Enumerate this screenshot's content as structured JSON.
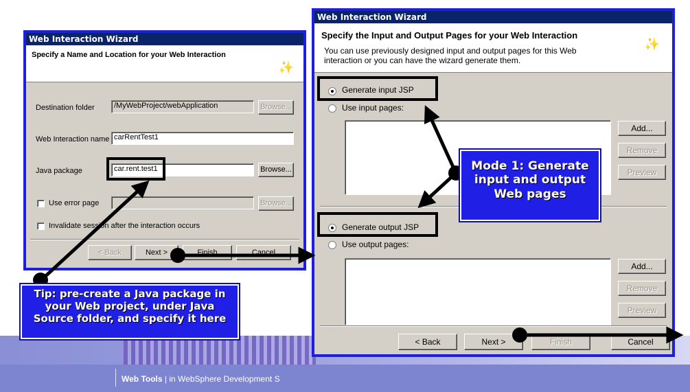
{
  "footer": {
    "brand": "Web Tools",
    "separator": "|",
    "subtitle": "in WebSphere Development S"
  },
  "wizard1": {
    "title": "Web Interaction Wizard",
    "heading": "Specify a Name and Location for your Web Interaction",
    "icon": "wizard-wand-icon",
    "destination_label": "Destination folder",
    "destination_value": "/MyWebProject/webApplication",
    "name_label": "Web Interaction name",
    "name_value": "carRentTest1",
    "package_label": "Java package",
    "package_value": "car.rent.test1",
    "browse": "Browse...",
    "error_label": "Use error page",
    "invalidate_label": "Invalidate session after the interaction occurs",
    "back": "< Back",
    "next": "Next >",
    "finish": "Finish",
    "cancel": "Cancel"
  },
  "wizard2": {
    "title": "Web Interaction Wizard",
    "heading": "Specify the Input and Output Pages for your Web Interaction",
    "description": "You can use previously designed input and output pages for this Web interaction or you can have the wizard generate them.",
    "icon": "wizard-wand-icon",
    "gen_input": "Generate input JSP",
    "use_input": "Use input pages:",
    "gen_output": "Generate output JSP",
    "use_output": "Use output pages:",
    "add": "Add...",
    "remove": "Remove",
    "preview": "Preview",
    "back": "< Back",
    "next": "Next >",
    "finish": "Finish",
    "cancel": "Cancel"
  },
  "callouts": {
    "tip": "Tip: pre-create a Java package in your Web project, under Java Source folder, and specify it here",
    "mode": "Mode 1: Generate input and output Web pages"
  },
  "colors": {
    "window_border": "#1d1ee0",
    "callout_bg": "#1f1fe6",
    "titlebar": "#0a246a"
  }
}
